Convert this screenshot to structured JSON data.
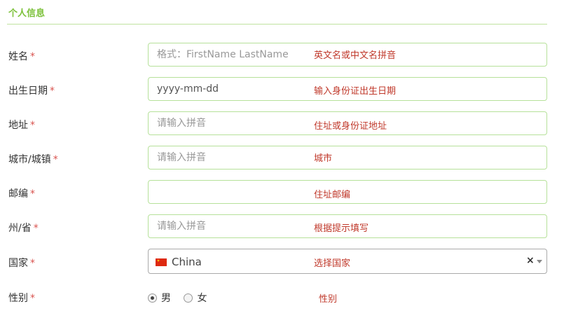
{
  "section": {
    "title": "个人信息"
  },
  "required_mark": "*",
  "fields": [
    {
      "label": "姓名",
      "placeholder": "格式：FirstName LastName",
      "value": "",
      "hint": "英文名或中文名拼音"
    },
    {
      "label": "出生日期",
      "placeholder": "",
      "value": "yyyy-mm-dd",
      "hint": "输入身份证出生日期"
    },
    {
      "label": "地址",
      "placeholder": "请输入拼音",
      "value": "",
      "hint": "住址或身份证地址"
    },
    {
      "label": "城市/城镇",
      "placeholder": "请输入拼音",
      "value": "",
      "hint": "城市"
    },
    {
      "label": "邮编",
      "placeholder": "",
      "value": "",
      "hint": "住址邮编"
    },
    {
      "label": "州/省",
      "placeholder": "请输入拼音",
      "value": "",
      "hint": "根据提示填写"
    }
  ],
  "country": {
    "label": "国家",
    "selected": "China",
    "hint": "选择国家",
    "clear": "×"
  },
  "gender": {
    "label": "性别",
    "options": [
      "男",
      "女"
    ],
    "selected": "男",
    "hint": "性别"
  },
  "colors": {
    "accent": "#7cc13a",
    "border": "#b6e19a",
    "hint": "#c0392b",
    "required": "#d9534f"
  }
}
